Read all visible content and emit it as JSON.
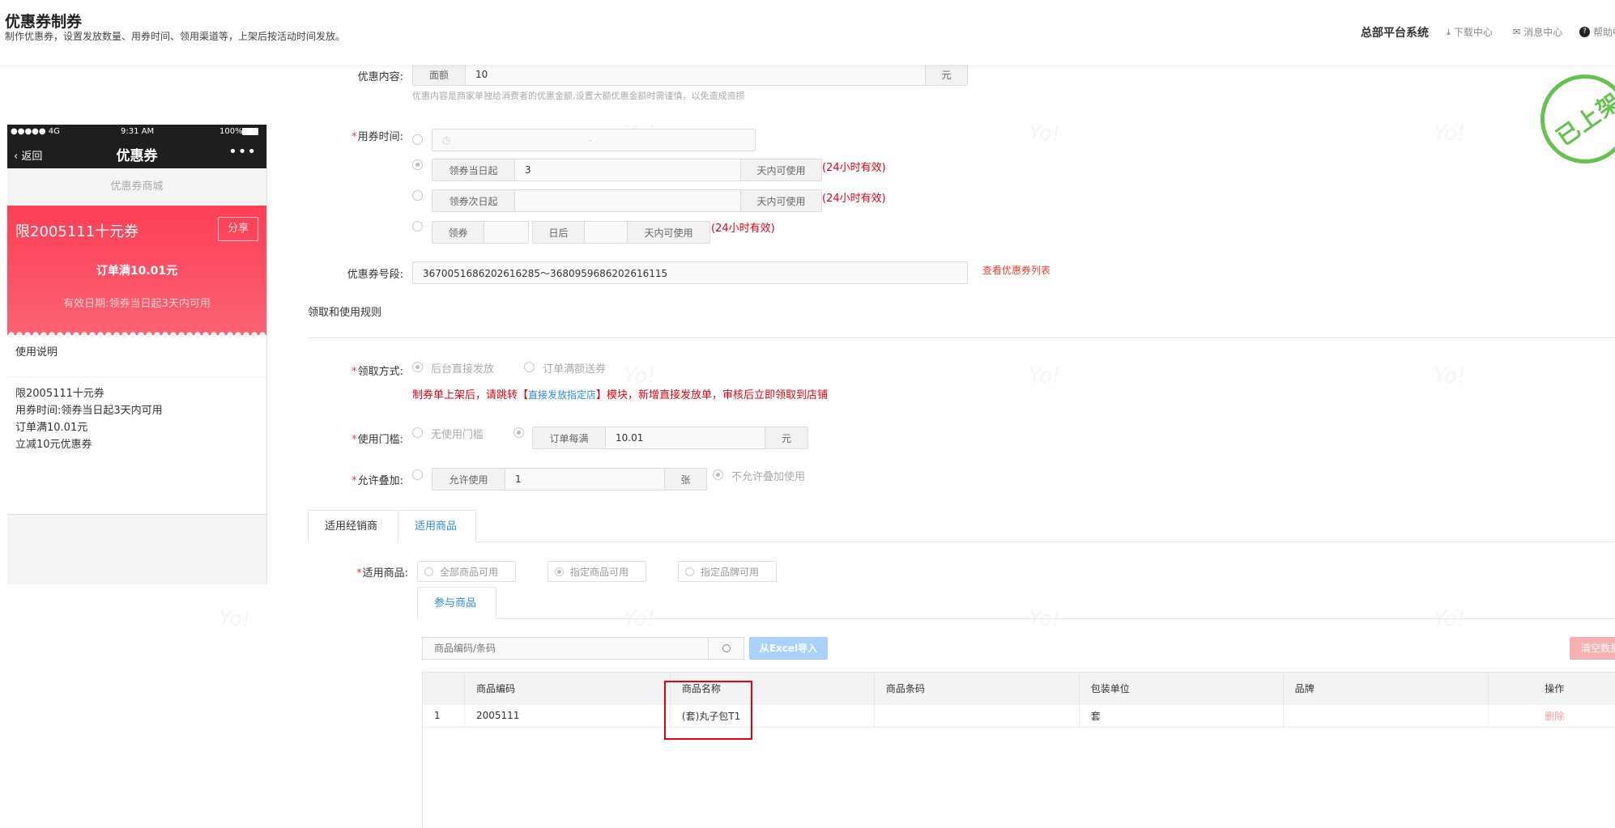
{
  "header": {
    "title": "优惠券制券",
    "subtitle": "制作优惠券，设置发放数量、用券时间、领用渠道等，上架后按活动时间发放。",
    "system_name": "总部平台系统",
    "download_center": "下载中心",
    "message_center": "消息中心",
    "help_center": "帮助中心"
  },
  "phone": {
    "status_carrier": "●●●●● 4G",
    "status_time": "9:31 AM",
    "status_battery": "100%",
    "back_label": "返回",
    "nav_title": "优惠券",
    "more": "•••",
    "mall_label": "优惠券商城",
    "coupon_title": "限2005111十元券",
    "share_label": "分享",
    "coupon_amount": "订单满10.01元",
    "coupon_valid": "有效日期:领券当日起3天内可用",
    "usage_title": "使用说明",
    "usage_lines": [
      "限2005111十元券",
      "用券时间:领券当日起3天内可用",
      "订单满10.01元",
      "立减10元优惠券"
    ]
  },
  "form": {
    "discount": {
      "label": "优惠内容:",
      "prefix": "面额",
      "value": "10",
      "suffix": "元",
      "hint": "优惠内容是商家单独给消费者的优惠金额,设置大额优惠金额时需谨慎，以免造成资损"
    },
    "usage_time": {
      "label": "用券时间:",
      "range_separator": "-",
      "opt2_prefix": "领券当日起",
      "opt2_value": "3",
      "opt2_suffix": "天内可使用",
      "opt2_note": "(24小时有效)",
      "opt3_prefix": "领券次日起",
      "opt3_value": "",
      "opt3_suffix": "天内可使用",
      "opt3_note": "(24小时有效)",
      "opt4_prefix": "领券",
      "opt4_mid": "日后",
      "opt4_suffix": "天内可使用",
      "opt4_note": "(24小时有效)"
    },
    "coupon_range": {
      "label": "优惠券号段:",
      "value": "3670051686202616285～3680959686202616115",
      "link": "查看优惠券列表"
    },
    "rules_section": "领取和使用规则",
    "claim_method": {
      "label": "领取方式:",
      "opt1": "后台直接发放",
      "opt2": "订单满额送券",
      "note_prefix": "制券单上架后，请跳转【",
      "note_link": "直接发放指定店",
      "note_suffix": "】模块，新增直接发放单，审核后立即领取到店铺"
    },
    "threshold": {
      "label": "使用门槛:",
      "opt1": "无使用门槛",
      "prefix": "订单每满",
      "value": "10.01",
      "suffix": "元"
    },
    "stacking": {
      "label": "允许叠加:",
      "prefix": "允许使用",
      "value": "1",
      "suffix": "张",
      "opt2": "不允许叠加使用"
    }
  },
  "tabs": [
    "适用经销商",
    "适用商品"
  ],
  "goods": {
    "label": "适用商品:",
    "opt_all": "全部商品可用",
    "opt_specified": "指定商品可用",
    "opt_brand": "指定品牌可用",
    "subtab": "参与商品",
    "search_placeholder": "商品编码/条码",
    "import_button": "从Excel导入",
    "clear_button": "清空数据",
    "columns": [
      "",
      "商品编码",
      "商品名称",
      "商品条码",
      "包装单位",
      "品牌",
      "操作"
    ],
    "rows": [
      {
        "index": "1",
        "code": "2005111",
        "name": "(套)丸子包T1",
        "barcode": "",
        "unit": "套",
        "brand": "",
        "action": "删除"
      }
    ]
  },
  "stamp": "已上架",
  "colors": {
    "accent": "#2a8df2",
    "danger": "#e60012",
    "stamp": "#66c24f",
    "coupon": "#fe3e55"
  }
}
